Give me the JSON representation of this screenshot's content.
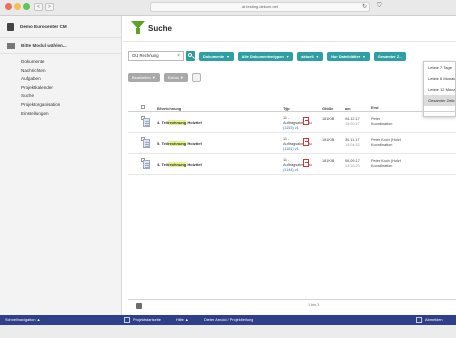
{
  "browser": {
    "url": "af.testing.dekom.net",
    "back": "<",
    "forward": ">"
  },
  "colors": {
    "accent_teal": "#2e9fa2",
    "brand_green": "#5fa127",
    "bottom_bar": "#303f8a",
    "highlight": "#e6f08c"
  },
  "sidebar": {
    "app_name": "Demo Eurocenter CM",
    "module_label": "Bitte Modul wählen...",
    "items": [
      {
        "label": "Dokumente"
      },
      {
        "label": "Nachrichten"
      },
      {
        "label": "Aufgaben"
      },
      {
        "label": "Projektkalender"
      },
      {
        "label": "Suche"
      },
      {
        "label": "Projektorganisation"
      },
      {
        "label": "Einstellungen"
      }
    ]
  },
  "page": {
    "title": "Suche"
  },
  "search": {
    "value": "GU Rechnung",
    "clear": "×"
  },
  "filters": [
    {
      "label": "Dokumente"
    },
    {
      "label": "Alle Dokumententypen"
    },
    {
      "label": "aktuell"
    },
    {
      "label": "Nur Dateiblätter"
    },
    {
      "label": "Gesamter Z..."
    }
  ],
  "actions": {
    "edit": "Bearbeiten",
    "extras": "Extras"
  },
  "time_dropdown": {
    "options": [
      "Letzte 7 Tage",
      "Letzte 6 Monate",
      "Letzte 12 Monate",
      "Gesamter Zeitraum"
    ],
    "selected_index": 3
  },
  "table": {
    "headers": {
      "name": "Bezeichnung",
      "type": "Typ",
      "size": "Größe",
      "date": "am",
      "author": "Erst",
      "sort": "⇕"
    },
    "rows": [
      {
        "name_pre": "4. Teil",
        "name_hl": "rechnung",
        "name_post": " Holztief",
        "type_num": "11 -",
        "type_name": "Auftragsabwicklu",
        "type_link": "(1153) v1",
        "size": "181KiB",
        "date": "04.12.17",
        "time": "15:00:47",
        "author": "Peter",
        "role": "Koordination"
      },
      {
        "name_pre": "5. Teil",
        "name_hl": "rechnung",
        "name_post": " Holztief",
        "type_num": "11 -",
        "type_name": "Auftragsabwicklu",
        "type_link": "(1161) v1",
        "size": "181KiB",
        "date": "30.11.17",
        "time": "14:04:52",
        "author": "Peter Koch (Holzt",
        "role": "Koordination"
      },
      {
        "name_pre": "4. Teil",
        "name_hl": "rechnung",
        "name_post": " Holztief",
        "type_num": "11 -",
        "type_name": "Auftragsabwicklu",
        "type_link": "(1144) v1",
        "size": "181KiB",
        "date": "06.09.17",
        "time": "13:16:23",
        "author": "Peter Koch (Holzt",
        "role": "Koordination"
      }
    ],
    "pager": "1 bis 3"
  },
  "bottombar": {
    "quick_nav": "Schnellnavigation ▲",
    "home": "Projektstartseite",
    "help": "Hilfe ▲",
    "context": "Dieter Arnold / Projektleitung",
    "logout": "Abmelden"
  }
}
